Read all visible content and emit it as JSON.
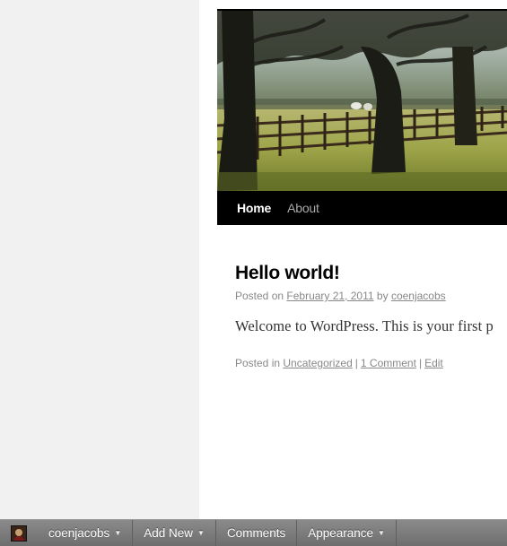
{
  "nav": {
    "items": [
      {
        "label": "Home",
        "current": true
      },
      {
        "label": "About",
        "current": false
      }
    ]
  },
  "post": {
    "title": "Hello world!",
    "meta": {
      "posted_on": "Posted on",
      "date": "February 21, 2011",
      "by": "by",
      "author": "coenjacobs"
    },
    "content": "Welcome to WordPress. This is your first p",
    "utility": {
      "posted_in": "Posted in",
      "category": "Uncategorized",
      "comments": "1 Comment",
      "edit": "Edit"
    }
  },
  "admin_bar": {
    "user": "coenjacobs",
    "add_new": "Add New",
    "comments": "Comments",
    "appearance": "Appearance",
    "caret": "▼"
  }
}
